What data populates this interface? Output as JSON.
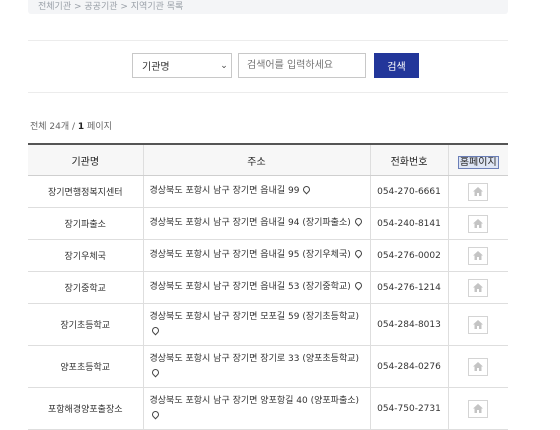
{
  "breadcrumb": {
    "text": "전체기관 > 공공기관 > 지역기관 목록"
  },
  "search": {
    "select_value": "기관명",
    "placeholder": "검색어를 입력하세요",
    "button_label": "검색"
  },
  "summary": {
    "prefix": "전체 24개 / ",
    "page": "1",
    "suffix": " 페이지"
  },
  "table": {
    "headers": {
      "name": "기관명",
      "address": "주소",
      "phone": "전화번호",
      "homepage": "홈페이지"
    },
    "rows": [
      {
        "name": "장기면행정복지센터",
        "address": "경상북도 포항시 남구 장기면 읍내길 99",
        "phone": "054-270-6661"
      },
      {
        "name": "장기파출소",
        "address": "경상북도 포항시 남구 장기면 읍내길 94 (장기파출소)",
        "phone": "054-240-8141"
      },
      {
        "name": "장기우체국",
        "address": "경상북도 포항시 남구 장기면 읍내길 95 (장기우체국)",
        "phone": "054-276-0002"
      },
      {
        "name": "장기중학교",
        "address": "경상북도 포항시 남구 장기면 읍내길 53 (장기중학교)",
        "phone": "054-276-1214"
      },
      {
        "name": "장기초등학교",
        "address": "경상북도 포항시 남구 장기면 모포길 59 (장기초등학교)",
        "phone": "054-284-8013"
      },
      {
        "name": "양포초등학교",
        "address": "경상북도 포항시 남구 장기면 장기로 33 (양포초등학교)",
        "phone": "054-284-0276"
      },
      {
        "name": "포항해경양포출장소",
        "address": "경상북도 포항시 남구 장기면 양포항길 40 (양포파출소)",
        "phone": "054-750-2731"
      }
    ]
  }
}
